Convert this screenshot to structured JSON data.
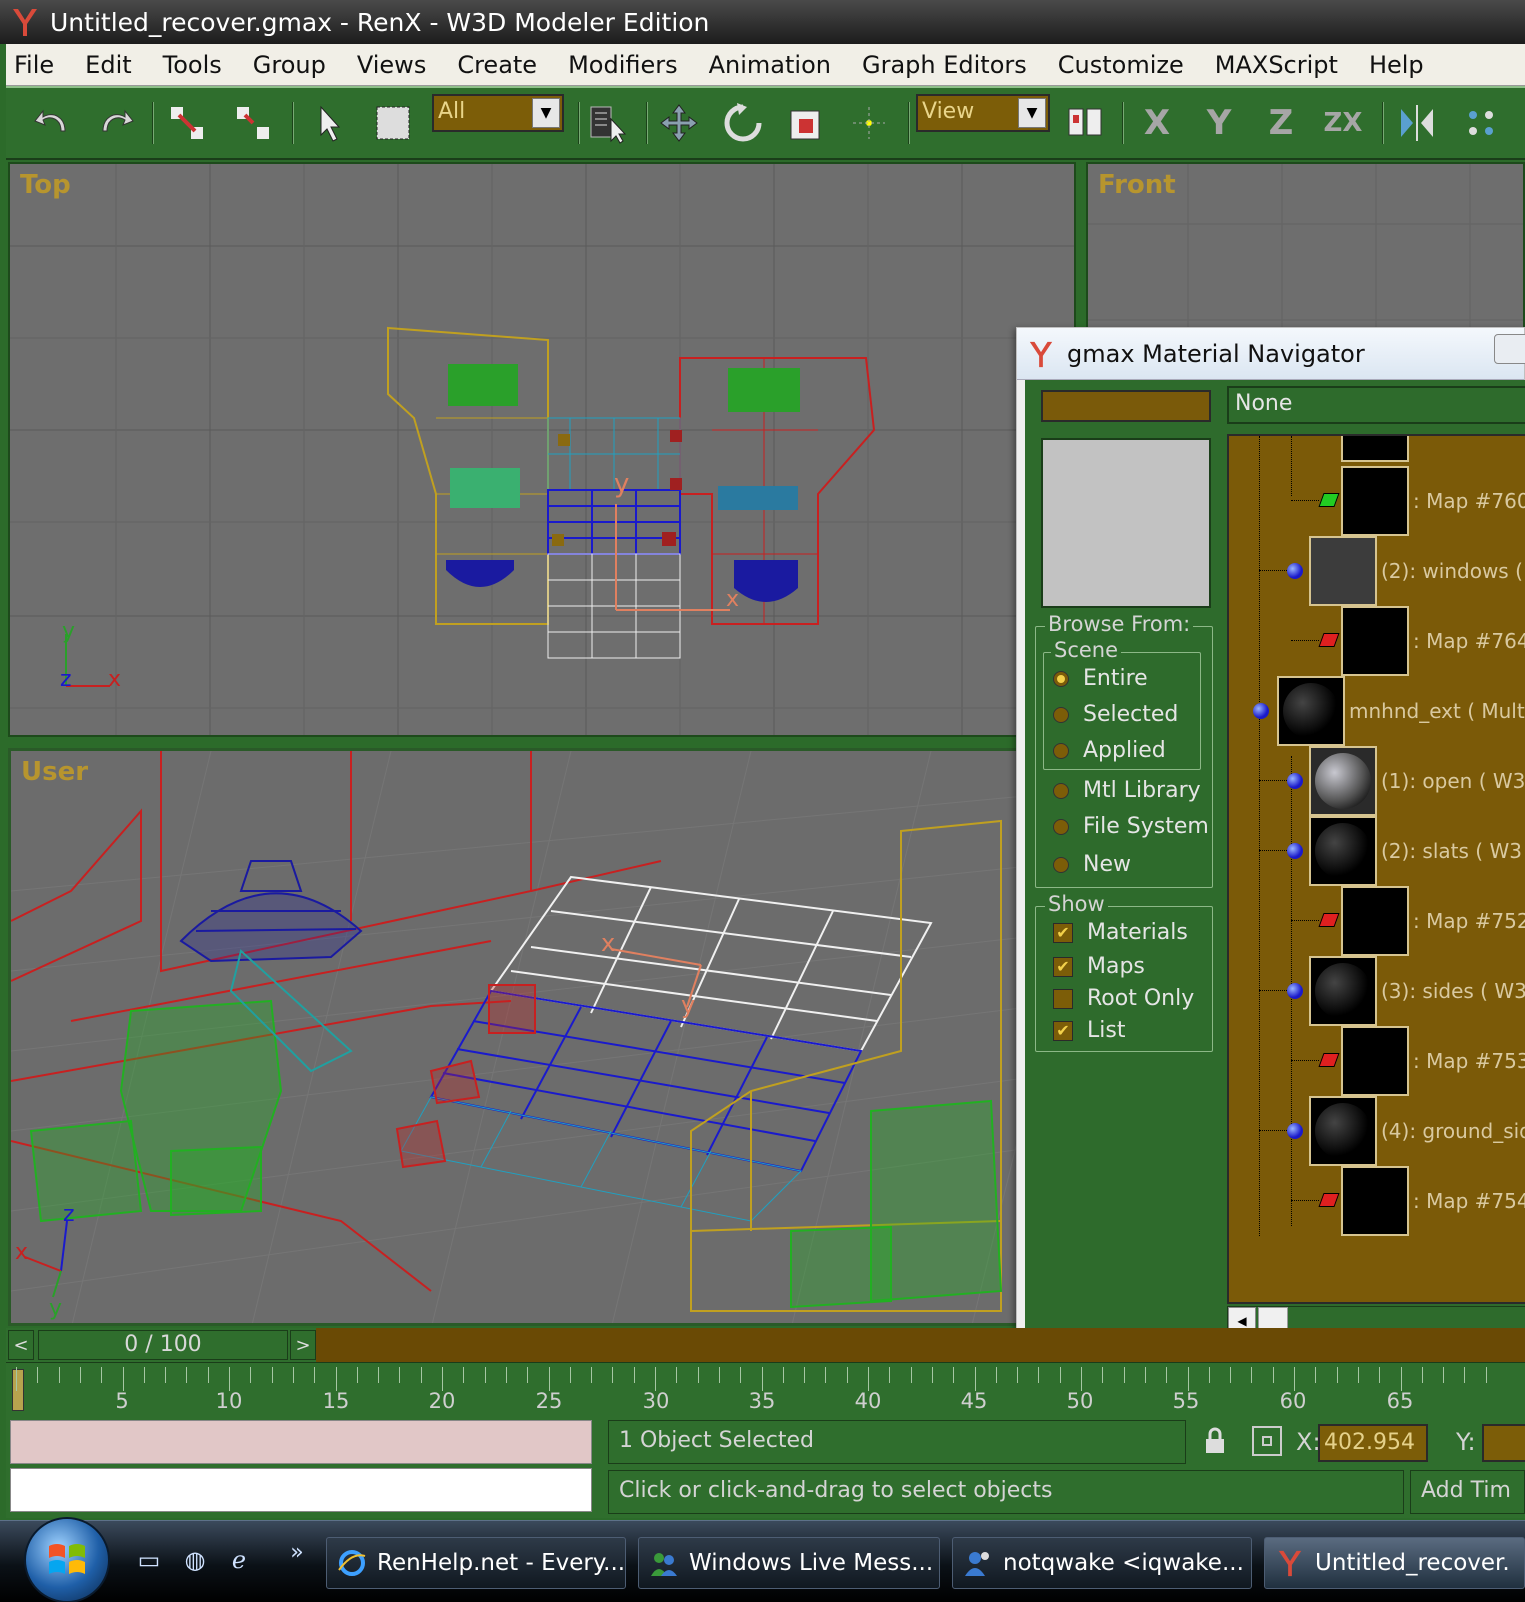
{
  "window": {
    "title": "Untitled_recover.gmax - RenX - W3D Modeler Edition"
  },
  "menu": [
    "File",
    "Edit",
    "Tools",
    "Group",
    "Views",
    "Create",
    "Modifiers",
    "Animation",
    "Graph Editors",
    "Customize",
    "MAXScript",
    "Help"
  ],
  "toolbar": {
    "selection_filter": "All",
    "reference_coord": "View",
    "axis_x": "X",
    "axis_y": "Y",
    "axis_z": "Z",
    "axis_zx": "ZX"
  },
  "viewports": {
    "top": "Top",
    "front": "Front",
    "user": "User"
  },
  "material_navigator": {
    "title": "gmax Material Navigator",
    "name_field": "None",
    "browse_from_label": "Browse From:",
    "scene_label": "Scene",
    "browse_options": [
      "Entire",
      "Selected",
      "Applied",
      "Mtl Library",
      "File System",
      "New"
    ],
    "browse_selected": "Entire",
    "show_label": "Show",
    "show_options": [
      {
        "label": "Materials",
        "checked": true
      },
      {
        "label": "Maps",
        "checked": true
      },
      {
        "label": "Root Only",
        "checked": false
      },
      {
        "label": "List",
        "checked": true
      }
    ],
    "tree_items": [
      {
        "label": ": Map #760",
        "kind": "map"
      },
      {
        "label": "(2): windows  (",
        "kind": "material"
      },
      {
        "label": ": Map #764",
        "kind": "map"
      },
      {
        "label": "mnhnd_ext  ( Mult",
        "kind": "root"
      },
      {
        "label": "(1): open  ( W3",
        "kind": "material"
      },
      {
        "label": "(2): slats  ( W3",
        "kind": "material"
      },
      {
        "label": ": Map #752",
        "kind": "map"
      },
      {
        "label": "(3): sides  ( W3",
        "kind": "material"
      },
      {
        "label": ": Map #753",
        "kind": "map"
      },
      {
        "label": "(4): ground_sid",
        "kind": "material"
      },
      {
        "label": ": Map #754",
        "kind": "map"
      }
    ]
  },
  "timeline": {
    "frame_display": "0 / 100",
    "ruler_labels": [
      "5",
      "10",
      "15",
      "20",
      "25",
      "30",
      "35",
      "40",
      "45",
      "50",
      "55",
      "60",
      "65"
    ]
  },
  "status": {
    "selection_info": "1 Object Selected",
    "prompt": "Click or click-and-drag to select objects",
    "x_label": "X:",
    "x_value": "402.954",
    "y_label": "Y:",
    "add_time_tag": "Add Tim"
  },
  "taskbar": {
    "tasks": [
      {
        "label": "RenHelp.net - Every...",
        "icon": "ie-icon"
      },
      {
        "label": "Windows Live Mess...",
        "icon": "messenger-icon"
      },
      {
        "label": "notqwake <iqwake...",
        "icon": "chat-icon"
      },
      {
        "label": "Untitled_recover.",
        "icon": "gmax-icon"
      }
    ]
  },
  "colors": {
    "ui_green": "#2f6e2d",
    "field_brown": "#7c5d08",
    "viewport_gray": "#6e6e6e",
    "viewport_label": "#b7952e"
  }
}
